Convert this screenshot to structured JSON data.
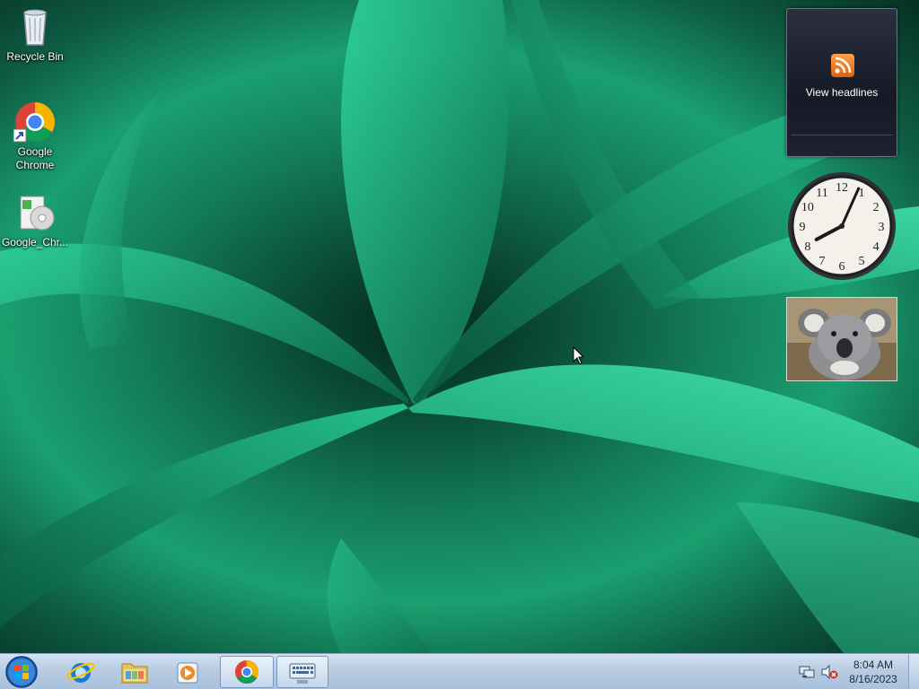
{
  "desktop": {
    "icons": [
      {
        "label": "Recycle Bin",
        "icon": "recycle-bin-icon"
      },
      {
        "label": "Google Chrome",
        "icon": "chrome-icon"
      },
      {
        "label": "Google_Chr...",
        "icon": "installer-icon"
      }
    ]
  },
  "gadgets": {
    "feed": {
      "label": "View headlines",
      "icon": "rss-icon"
    },
    "clock": {
      "hour": 8,
      "minute": 4,
      "numerals": [
        "12",
        "1",
        "2",
        "3",
        "4",
        "5",
        "6",
        "7",
        "8",
        "9",
        "10",
        "11"
      ]
    },
    "slideshow": {
      "subject": "koala"
    }
  },
  "taskbar": {
    "start": {
      "icon": "windows-start-icon"
    },
    "pinned": [
      {
        "name": "Internet Explorer",
        "icon": "ie-icon"
      },
      {
        "name": "Windows Explorer",
        "icon": "folder-icon"
      },
      {
        "name": "Windows Media Player",
        "icon": "media-player-icon"
      },
      {
        "name": "Google Chrome",
        "icon": "chrome-icon",
        "active": true
      },
      {
        "name": "On-Screen Keyboard",
        "icon": "keyboard-icon",
        "active": true
      }
    ],
    "tray": {
      "icons": [
        "network-icon",
        "volume-muted-icon"
      ],
      "time": "8:04 AM",
      "date": "8/16/2023"
    }
  }
}
